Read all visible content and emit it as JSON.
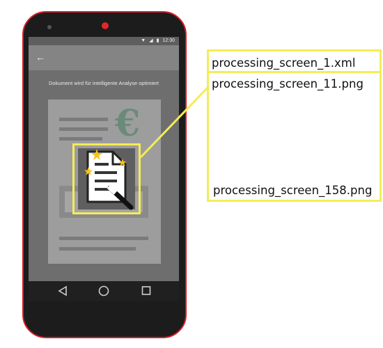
{
  "device": {
    "frame_color": "#d4202a",
    "status_bar": {
      "time": "12:30",
      "icons": [
        "wifi-icon",
        "signal-icon",
        "battery-icon"
      ]
    },
    "app_bar": {
      "back_icon": "back-arrow-icon"
    },
    "screen_subtitle": "Dokument wird für intelligente Analyse optimiert",
    "illustration": {
      "currency_symbol": "€",
      "icon": "document-magic-wand-icon"
    },
    "nav_bar": {
      "icons": [
        "back-triangle-icon",
        "home-circle-icon",
        "recents-square-icon"
      ]
    }
  },
  "annotations": {
    "highlight_color": "#f5ec57",
    "xml_file": "processing_screen_1.xml",
    "first_png": "processing_screen_11.png",
    "last_png": "processing_screen_158.png"
  }
}
